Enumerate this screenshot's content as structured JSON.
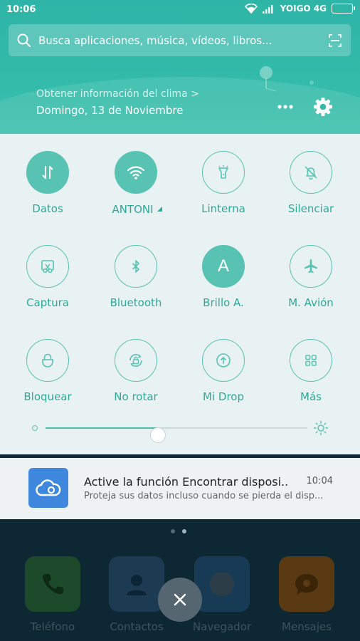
{
  "status_bar": {
    "time": "10:06",
    "carrier": "YOIGO 4G"
  },
  "search": {
    "placeholder": "Busca aplicaciones, música, vídeos, libros..."
  },
  "weather": {
    "link_text": "Obtener información del clima >",
    "date": "Domingo, 13 de Noviembre"
  },
  "quick_settings": {
    "tiles": [
      {
        "label": "Datos",
        "icon": "data-arrows-icon",
        "active": true
      },
      {
        "label": "ANTONI",
        "icon": "wifi-icon",
        "active": true
      },
      {
        "label": "Linterna",
        "icon": "flashlight-icon",
        "active": false
      },
      {
        "label": "Silenciar",
        "icon": "bell-off-icon",
        "active": false
      },
      {
        "label": "Captura",
        "icon": "scissors-icon",
        "active": false
      },
      {
        "label": "Bluetooth",
        "icon": "bluetooth-icon",
        "active": false
      },
      {
        "label": "Brillo A.",
        "icon": "auto-brightness-icon",
        "active": true,
        "glyph": "A"
      },
      {
        "label": "M. Avión",
        "icon": "airplane-icon",
        "active": false
      },
      {
        "label": "Bloquear",
        "icon": "lock-icon",
        "active": false
      },
      {
        "label": "No rotar",
        "icon": "rotation-lock-icon",
        "active": false
      },
      {
        "label": "Mi Drop",
        "icon": "upload-icon",
        "active": false
      },
      {
        "label": "Más",
        "icon": "grid-icon",
        "active": false
      }
    ],
    "brightness_level": 0.43,
    "accent_color": "#58c2b3"
  },
  "notification": {
    "title": "Active la función Encontrar disposi..",
    "time": "10:04",
    "body": "Proteja sus datos incluso cuando se pierda el disp..."
  },
  "dock": {
    "apps": [
      {
        "label": "Teléfono",
        "icon": "phone-icon",
        "color": "#1d4a2a"
      },
      {
        "label": "Contactos",
        "icon": "contact-icon",
        "color": "#1c3b52"
      },
      {
        "label": "Navegador",
        "icon": "browser-icon",
        "color": "#173b54"
      },
      {
        "label": "Mensajes",
        "icon": "message-icon",
        "color": "#5a3a12"
      }
    ],
    "pages": 2,
    "active_page": 1
  }
}
